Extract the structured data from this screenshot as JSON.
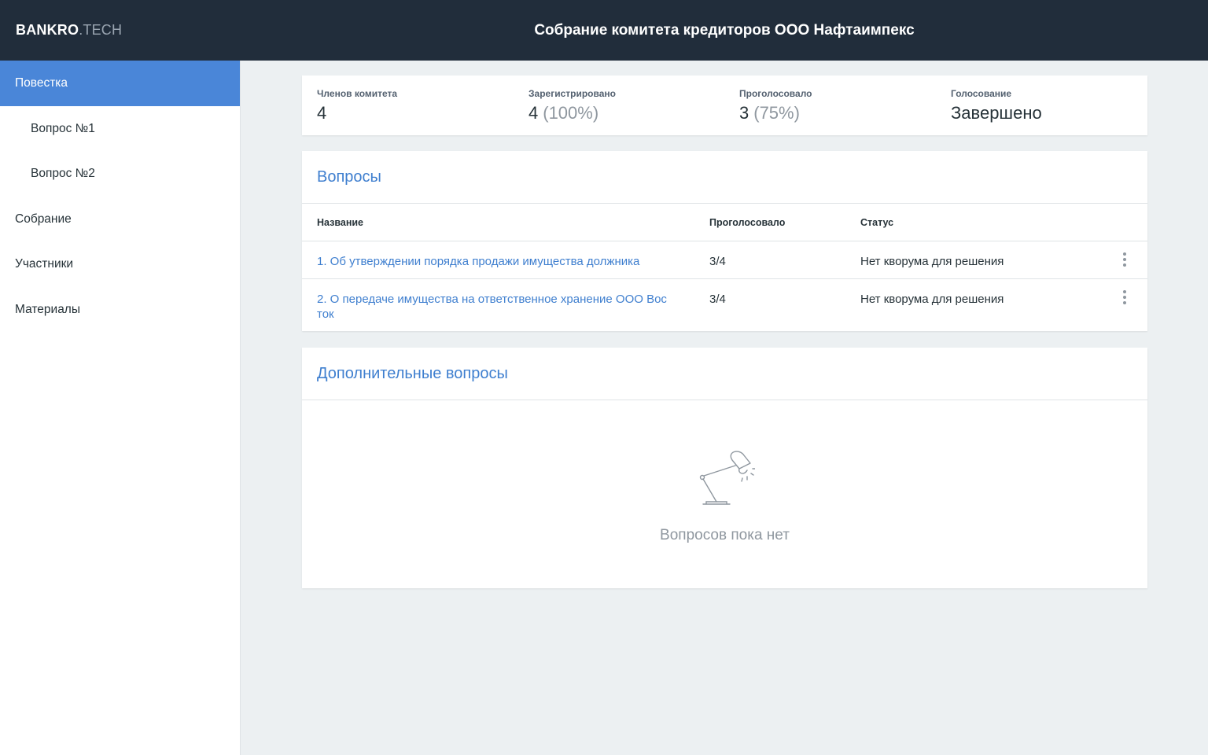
{
  "header": {
    "logo_main": "BANKRO",
    "logo_sub": ".TECH",
    "title": "Собрание комитета кредиторов ООО Нафтаимпекс"
  },
  "sidebar": {
    "items": [
      {
        "label": "Повестка"
      },
      {
        "label": "Вопрос №1"
      },
      {
        "label": "Вопрос №2"
      },
      {
        "label": "Собрание"
      },
      {
        "label": "Участники"
      },
      {
        "label": "Материалы"
      }
    ]
  },
  "stats": {
    "members_label": "Членов комитета",
    "members_value": "4",
    "registered_label": "Зарегистрировано",
    "registered_value": "4",
    "registered_pct": "(100%)",
    "voted_label": "Проголосовало",
    "voted_value": "3",
    "voted_pct": "(75%)",
    "voting_label": "Голосование",
    "voting_value": "Завершено"
  },
  "questions": {
    "title": "Вопросы",
    "columns": {
      "name": "Название",
      "votes": "Проголосовало",
      "status": "Статус"
    },
    "rows": [
      {
        "name": "1. Об утверждении порядка продажи имущества должника",
        "votes": "3/4",
        "status": "Нет кворума для решения"
      },
      {
        "name": "2. О передаче имущества на ответственное хранение ООО Вос ток",
        "votes": "3/4",
        "status": "Нет кворума для решения"
      }
    ]
  },
  "extra": {
    "title": "Дополнительные вопросы",
    "empty_text": "Вопросов пока нет",
    "empty_icon": "desk-lamp-icon"
  },
  "colors": {
    "topbar": "#212d3b",
    "accent": "#4a86d8",
    "link": "#3f7fcf",
    "background": "#ecf0f2"
  }
}
